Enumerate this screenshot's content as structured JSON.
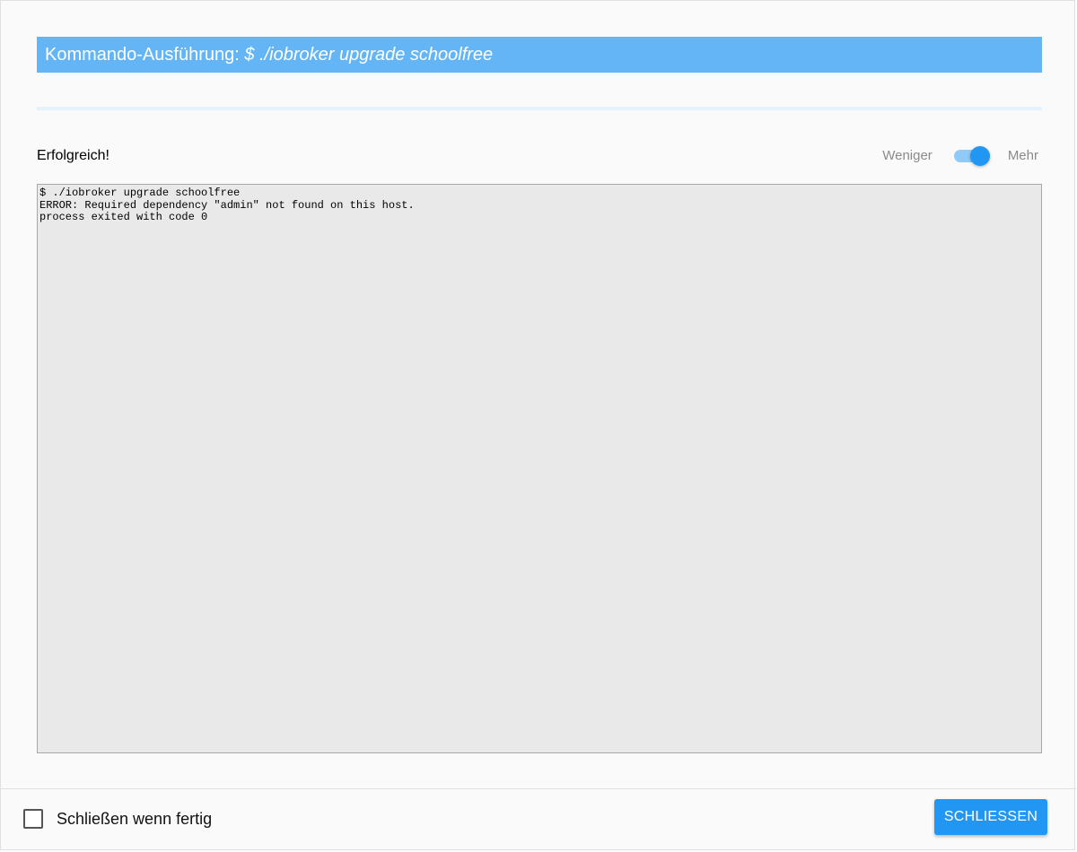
{
  "dialog": {
    "title_prefix": "Kommando-Ausführung: ",
    "title_command": "$ ./iobroker upgrade schoolfree",
    "progress_percent": 100,
    "status_text": "Erfolgreich!",
    "toggle": {
      "label_less": "Weniger",
      "label_more": "Mehr",
      "checked": true
    },
    "console": {
      "lines": [
        "$ ./iobroker upgrade schoolfree",
        "ERROR: Required dependency \"admin\" not found on this host.",
        "process exited with code 0"
      ]
    },
    "footer": {
      "close_when_done_label": "Schließen wenn fertig",
      "close_when_done_checked": false,
      "close_button_label": "SCHLIESSEN"
    }
  },
  "colors": {
    "title_bar": "#64b5f6",
    "accent": "#2196f3",
    "console_bg": "#e9e9e9"
  }
}
